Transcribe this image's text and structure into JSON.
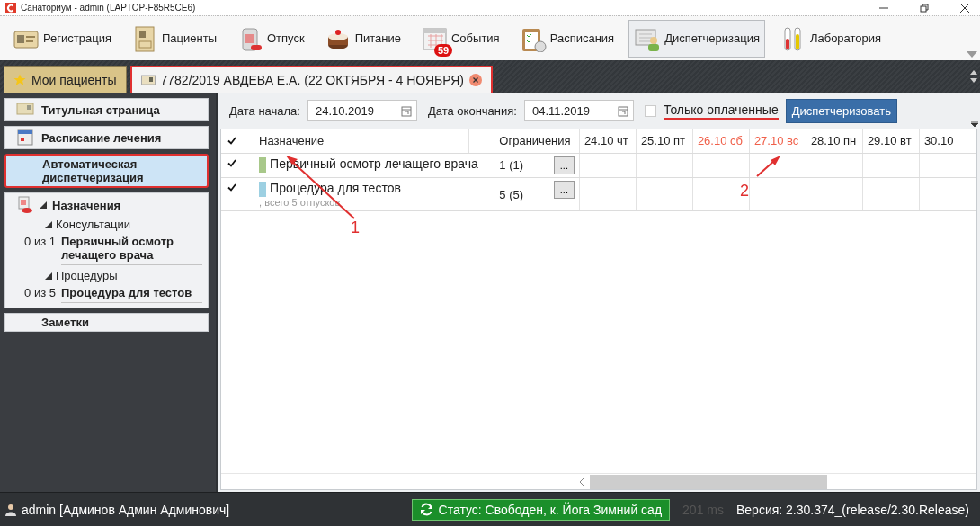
{
  "window": {
    "title": "Санаториум - admin (LAPTOP-F85R5CE6)"
  },
  "toolbar": [
    {
      "label": "Регистрация",
      "kind": "card",
      "selected": false
    },
    {
      "label": "Пациенты",
      "kind": "document",
      "selected": false
    },
    {
      "label": "Отпуск",
      "kind": "pills",
      "selected": false
    },
    {
      "label": "Питание",
      "kind": "cake",
      "selected": false
    },
    {
      "label": "События",
      "kind": "calendar",
      "selected": false,
      "badge": "59"
    },
    {
      "label": "Расписания",
      "kind": "clipboard",
      "selected": false
    },
    {
      "label": "Диспетчеризация",
      "kind": "dispatch",
      "selected": true
    },
    {
      "label": "Лаборатория",
      "kind": "tubes",
      "selected": false
    }
  ],
  "tabs": [
    {
      "label": "Мои пациенты",
      "kind": "home",
      "selected": false,
      "highlighted": false
    },
    {
      "label": "7782/2019 АВДЕВА Е.А. (22 ОКТЯБРЯ - 4 НОЯБРЯ)",
      "kind": "patient",
      "selected": true,
      "highlighted": true
    }
  ],
  "sidebar": {
    "items": [
      {
        "label": "Титульная страница",
        "kind": "title",
        "selected": false,
        "highlighted": false
      },
      {
        "label": "Расписание лечения",
        "kind": "schedule",
        "selected": false,
        "highlighted": false
      },
      {
        "label": "Автоматическая диспетчеризация",
        "kind": "page",
        "selected": true,
        "highlighted": true
      },
      {
        "label": "Назначения",
        "kind": "tree",
        "expanded": true,
        "children": [
          {
            "label": "Консультации",
            "expanded": true,
            "children": [
              {
                "count": "0 из 1",
                "label": "Первичный осмотр лечащего врача"
              }
            ]
          },
          {
            "label": "Процедуры",
            "expanded": true,
            "children": [
              {
                "count": "0 из 5",
                "label": "Процедура для тестов"
              }
            ]
          }
        ]
      },
      {
        "label": "Заметки",
        "kind": "page",
        "selected": false,
        "highlighted": false
      }
    ]
  },
  "filters": {
    "start_label": "Дата начала:",
    "start_value": "24.10.2019",
    "end_label": "Дата окончания:",
    "end_value": "04.11.2019",
    "paid_only": {
      "label": "Только оплаченные",
      "checked": false,
      "underlined": true
    },
    "button": "Диспетчеризовать"
  },
  "table": {
    "all_checked": true,
    "columns": [
      "Назначение",
      "Ограничения"
    ],
    "days": [
      {
        "label": "24.10 чт",
        "weekend": false
      },
      {
        "label": "25.10 пт",
        "weekend": false
      },
      {
        "label": "26.10 сб",
        "weekend": true
      },
      {
        "label": "27.10 вс",
        "weekend": true
      },
      {
        "label": "28.10 пн",
        "weekend": false
      },
      {
        "label": "29.10 вт",
        "weekend": false
      },
      {
        "label": "30.10",
        "weekend": false
      }
    ],
    "rows": [
      {
        "checked": true,
        "color": "#a8c88a",
        "name": "Первичный осмотр лечащего врача",
        "limit": "1 (1)",
        "button": "..."
      },
      {
        "checked": true,
        "color": "#9dd0e2",
        "name": "Процедура для тестов",
        "note": ", всего 5 отпусков",
        "limit": "5 (5)",
        "button": "..."
      }
    ]
  },
  "annotations": [
    {
      "label": "1"
    },
    {
      "label": "2"
    }
  ],
  "status_bar": {
    "user": "admin [Админов Админ Админович]",
    "status": "Статус: Свободен, к. Йога Зимний сад",
    "latency": "201 ms",
    "version": "Версия: 2.30.374_(release/2.30.Release)"
  }
}
